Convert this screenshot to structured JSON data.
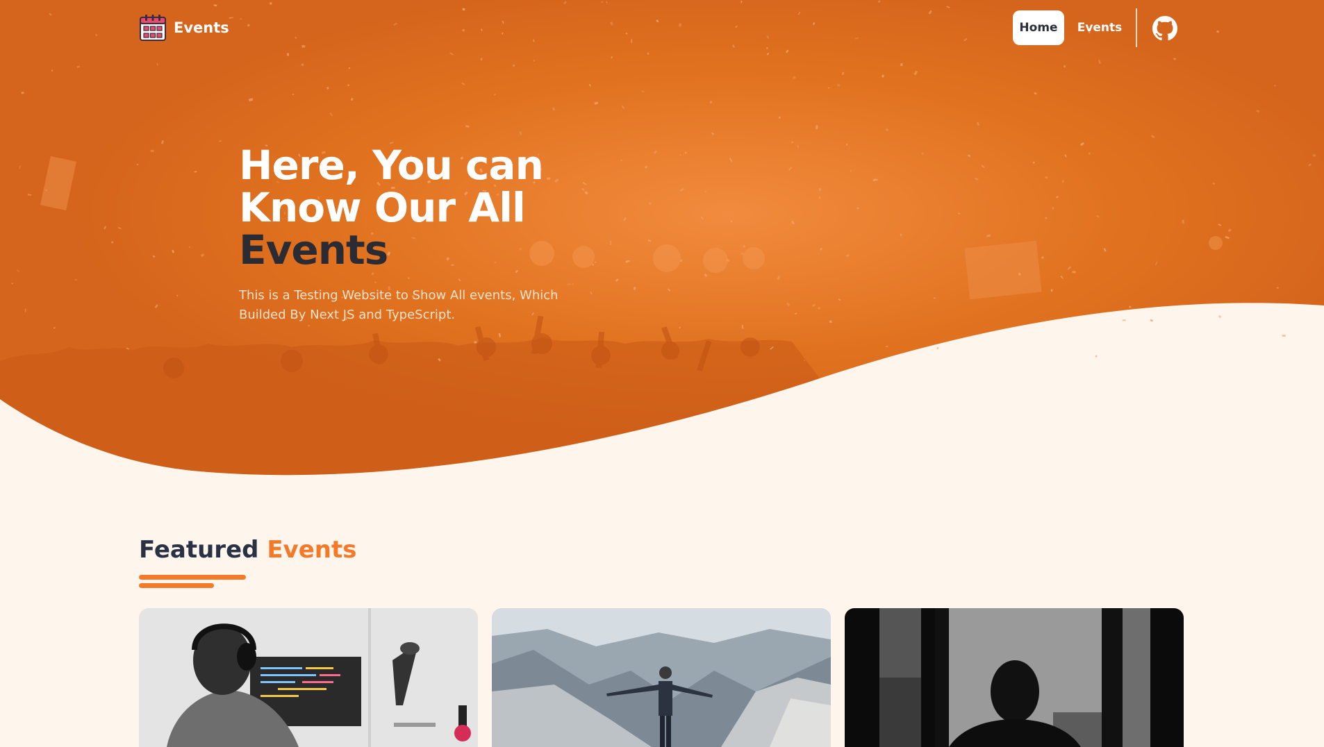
{
  "nav": {
    "brand_label": "Events",
    "brand_icon": "calendar-icon",
    "home_label": "Home",
    "events_label": "Events",
    "github_icon": "github-icon"
  },
  "hero": {
    "title_line1": "Here, You can",
    "title_line2": "Know Our All",
    "title_highlight": "Events",
    "subtitle": "This is a Testing Website to Show All events, Which Builded By Next JS and TypeScript."
  },
  "featured": {
    "heading_main": "Featured",
    "heading_accent": "Events"
  },
  "cards": [
    {
      "image": "person-coding-at-desk-photo"
    },
    {
      "image": "person-on-mountain-cliff-photo"
    },
    {
      "image": "silhouette-at-window-photo"
    }
  ],
  "colors": {
    "brand_orange": "#d5641c",
    "accent_orange": "#f47a2a",
    "page_background": "#fef6ed",
    "dark_text": "#2b2b33"
  }
}
